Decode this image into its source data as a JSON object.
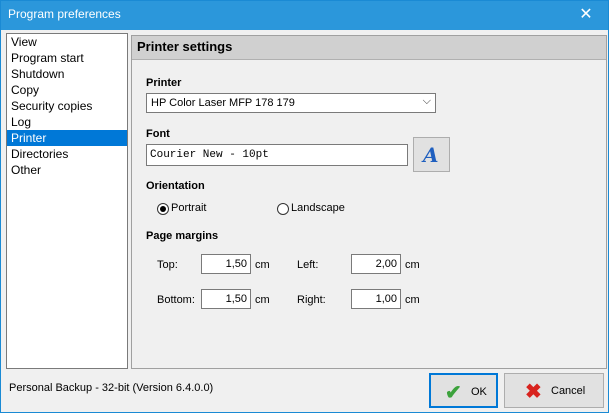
{
  "window": {
    "title": "Program preferences",
    "close_glyph": "✕"
  },
  "nav": {
    "items": [
      {
        "label": "View"
      },
      {
        "label": "Program start"
      },
      {
        "label": "Shutdown"
      },
      {
        "label": "Copy"
      },
      {
        "label": "Security copies"
      },
      {
        "label": "Log"
      },
      {
        "label": "Printer",
        "selected": true
      },
      {
        "label": "Directories"
      },
      {
        "label": "Other"
      }
    ]
  },
  "panel": {
    "title": "Printer settings",
    "printer": {
      "label": "Printer",
      "value": "HP Color Laser MFP 178 179"
    },
    "font": {
      "label": "Font",
      "value": "Courier New - 10pt",
      "button_icon": "font-icon",
      "button_glyph": "A"
    },
    "orientation": {
      "label": "Orientation",
      "options": [
        {
          "label": "Portrait",
          "checked": true
        },
        {
          "label": "Landscape",
          "checked": false
        }
      ]
    },
    "margins": {
      "label": "Page margins",
      "unit": "cm",
      "top": {
        "label": "Top:",
        "value": "1,50"
      },
      "left": {
        "label": "Left:",
        "value": "2,00"
      },
      "bottom": {
        "label": "Bottom:",
        "value": "1,50"
      },
      "right": {
        "label": "Right:",
        "value": "1,00"
      }
    }
  },
  "status": {
    "text": "Personal Backup - 32-bit (Version 6.4.0.0)"
  },
  "buttons": {
    "ok": {
      "label": "OK",
      "icon": "checkmark-icon",
      "glyph": "✔",
      "color": "#3ca23c"
    },
    "cancel": {
      "label": "Cancel",
      "icon": "cross-icon",
      "glyph": "✖",
      "color": "#d8231e"
    }
  },
  "colors": {
    "titlebar": "#2b97db",
    "selection": "#0078d7",
    "panel_header": "#d0d0d0"
  }
}
